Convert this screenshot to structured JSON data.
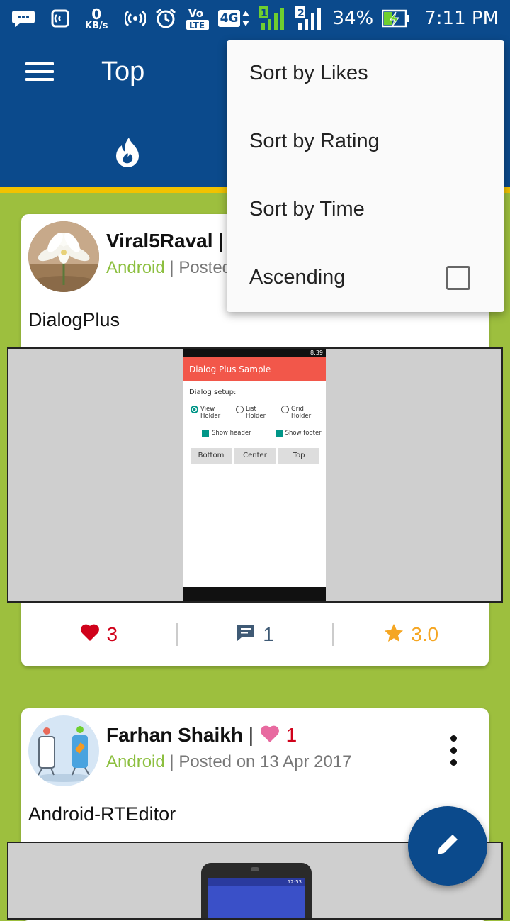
{
  "status_bar": {
    "kb_value": "0",
    "kb_unit": "KB/s",
    "network_4g": "4G",
    "sim1": "1",
    "sim2": "2",
    "battery": "34%",
    "time": "7:11 PM",
    "icons": [
      "chat-bubble-icon",
      "nfc-icon",
      "hotspot-icon",
      "alarm-icon",
      "volte-icon",
      "4g-icon",
      "signal-sim1-icon",
      "signal-sim2-icon",
      "battery-charging-icon"
    ]
  },
  "app_bar": {
    "title": "Top",
    "menu_icon": "hamburger-menu-icon",
    "active_tab_icon": "flame-icon",
    "color": "#0b4a8c",
    "accent": "#f2c200"
  },
  "sort_menu": {
    "items": [
      "Sort by Likes",
      "Sort by Rating",
      "Sort by Time"
    ],
    "ascending_label": "Ascending",
    "ascending_checked": false
  },
  "posts": [
    {
      "author": "Viral5Raval",
      "separator": "|",
      "category": "Android",
      "meta_sep": " | ",
      "posted": "Posted",
      "title": "DialogPlus",
      "likes": "3",
      "comments": "1",
      "rating": "3.0",
      "preview": {
        "status_time": "8:39",
        "app_title": "Dialog Plus Sample",
        "section": "Dialog setup:",
        "radios": [
          "View Holder",
          "List Holder",
          "Grid Holder"
        ],
        "checks": [
          "Show header",
          "Show footer"
        ],
        "buttons": [
          "Bottom",
          "Center",
          "Top"
        ]
      }
    },
    {
      "author": "Farhan Shaikh",
      "separator": "|",
      "header_likes": "1",
      "category": "Android",
      "meta_sep": " | ",
      "posted": "Posted on 13 Apr 2017",
      "title": "Android-RTEditor",
      "preview_time": "12:53"
    }
  ],
  "colors": {
    "background": "#9dbf3e",
    "like": "#d0021b",
    "comment": "#3f5a75",
    "rating": "#f5a623",
    "category": "#8cbf3f"
  }
}
